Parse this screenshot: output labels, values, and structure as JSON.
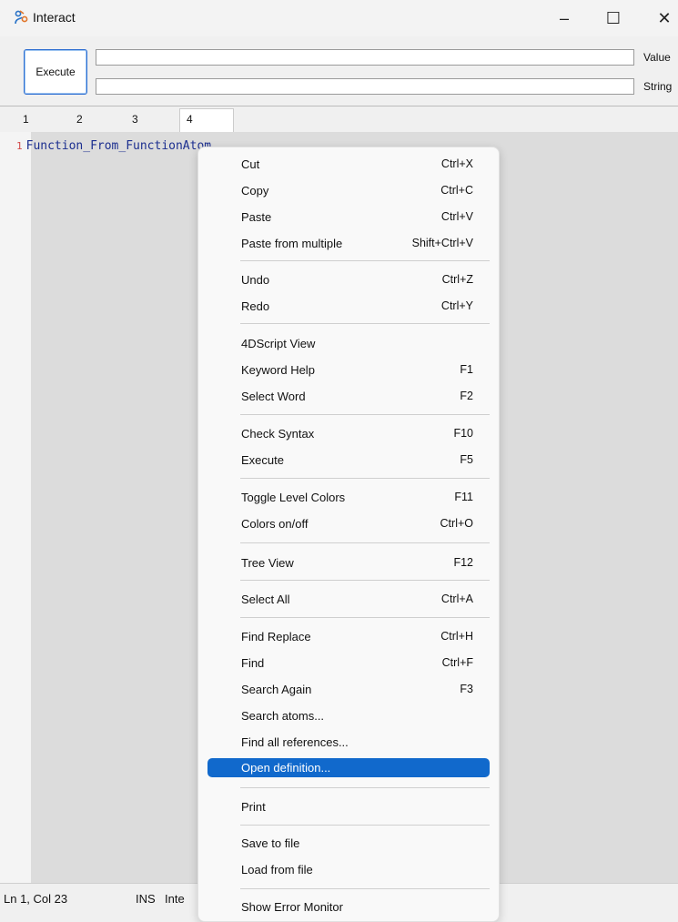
{
  "window": {
    "title": "Interact",
    "controls": {
      "minimize": "–",
      "maximize": "☐",
      "close": "✕"
    },
    "icon": "interact-app-icon"
  },
  "toolbar": {
    "execute_label": "Execute",
    "value_label": "Value",
    "string_label": "String",
    "value_field": "",
    "string_field": ""
  },
  "tabs": [
    "1",
    "2",
    "3",
    "4"
  ],
  "editor": {
    "line_number": "1",
    "code": "Function_From_FunctionAtom"
  },
  "status": {
    "position": "Ln 1, Col 23",
    "mode": "INS",
    "extra": "Inte"
  },
  "context_menu": {
    "items": [
      {
        "label": "Cut",
        "shortcut": "Ctrl+X"
      },
      {
        "label": "Copy",
        "shortcut": "Ctrl+C"
      },
      {
        "label": "Paste",
        "shortcut": "Ctrl+V"
      },
      {
        "label": "Paste from multiple",
        "shortcut": "Shift+Ctrl+V"
      },
      {
        "label": "Undo",
        "shortcut": "Ctrl+Z"
      },
      {
        "label": "Redo",
        "shortcut": "Ctrl+Y"
      },
      {
        "label": "4DScript View",
        "shortcut": ""
      },
      {
        "label": "Keyword Help",
        "shortcut": "F1"
      },
      {
        "label": "Select Word",
        "shortcut": "F2"
      },
      {
        "label": "Check Syntax",
        "shortcut": "F10"
      },
      {
        "label": "Execute",
        "shortcut": "F5"
      },
      {
        "label": "Toggle Level Colors",
        "shortcut": "F11"
      },
      {
        "label": "Colors on/off",
        "shortcut": "Ctrl+O"
      },
      {
        "label": "Tree View",
        "shortcut": "F12"
      },
      {
        "label": "Select All",
        "shortcut": "Ctrl+A"
      },
      {
        "label": "Find  Replace",
        "shortcut": "Ctrl+H"
      },
      {
        "label": "Find",
        "shortcut": "Ctrl+F"
      },
      {
        "label": "Search Again",
        "shortcut": "F3"
      },
      {
        "label": "Search atoms...",
        "shortcut": ""
      },
      {
        "label": "Find all references...",
        "shortcut": ""
      },
      {
        "label": "Open definition...",
        "shortcut": ""
      },
      {
        "label": "Print",
        "shortcut": ""
      },
      {
        "label": "Save to file",
        "shortcut": ""
      },
      {
        "label": "Load from file",
        "shortcut": ""
      },
      {
        "label": "Show Error Monitor",
        "shortcut": ""
      }
    ],
    "selected_label": "Open definition..."
  },
  "colors": {
    "accent": "#1169cc",
    "code_text": "#1b2e8f",
    "line_number": "#d24a4a",
    "editor_background": "#dcdcdc"
  }
}
